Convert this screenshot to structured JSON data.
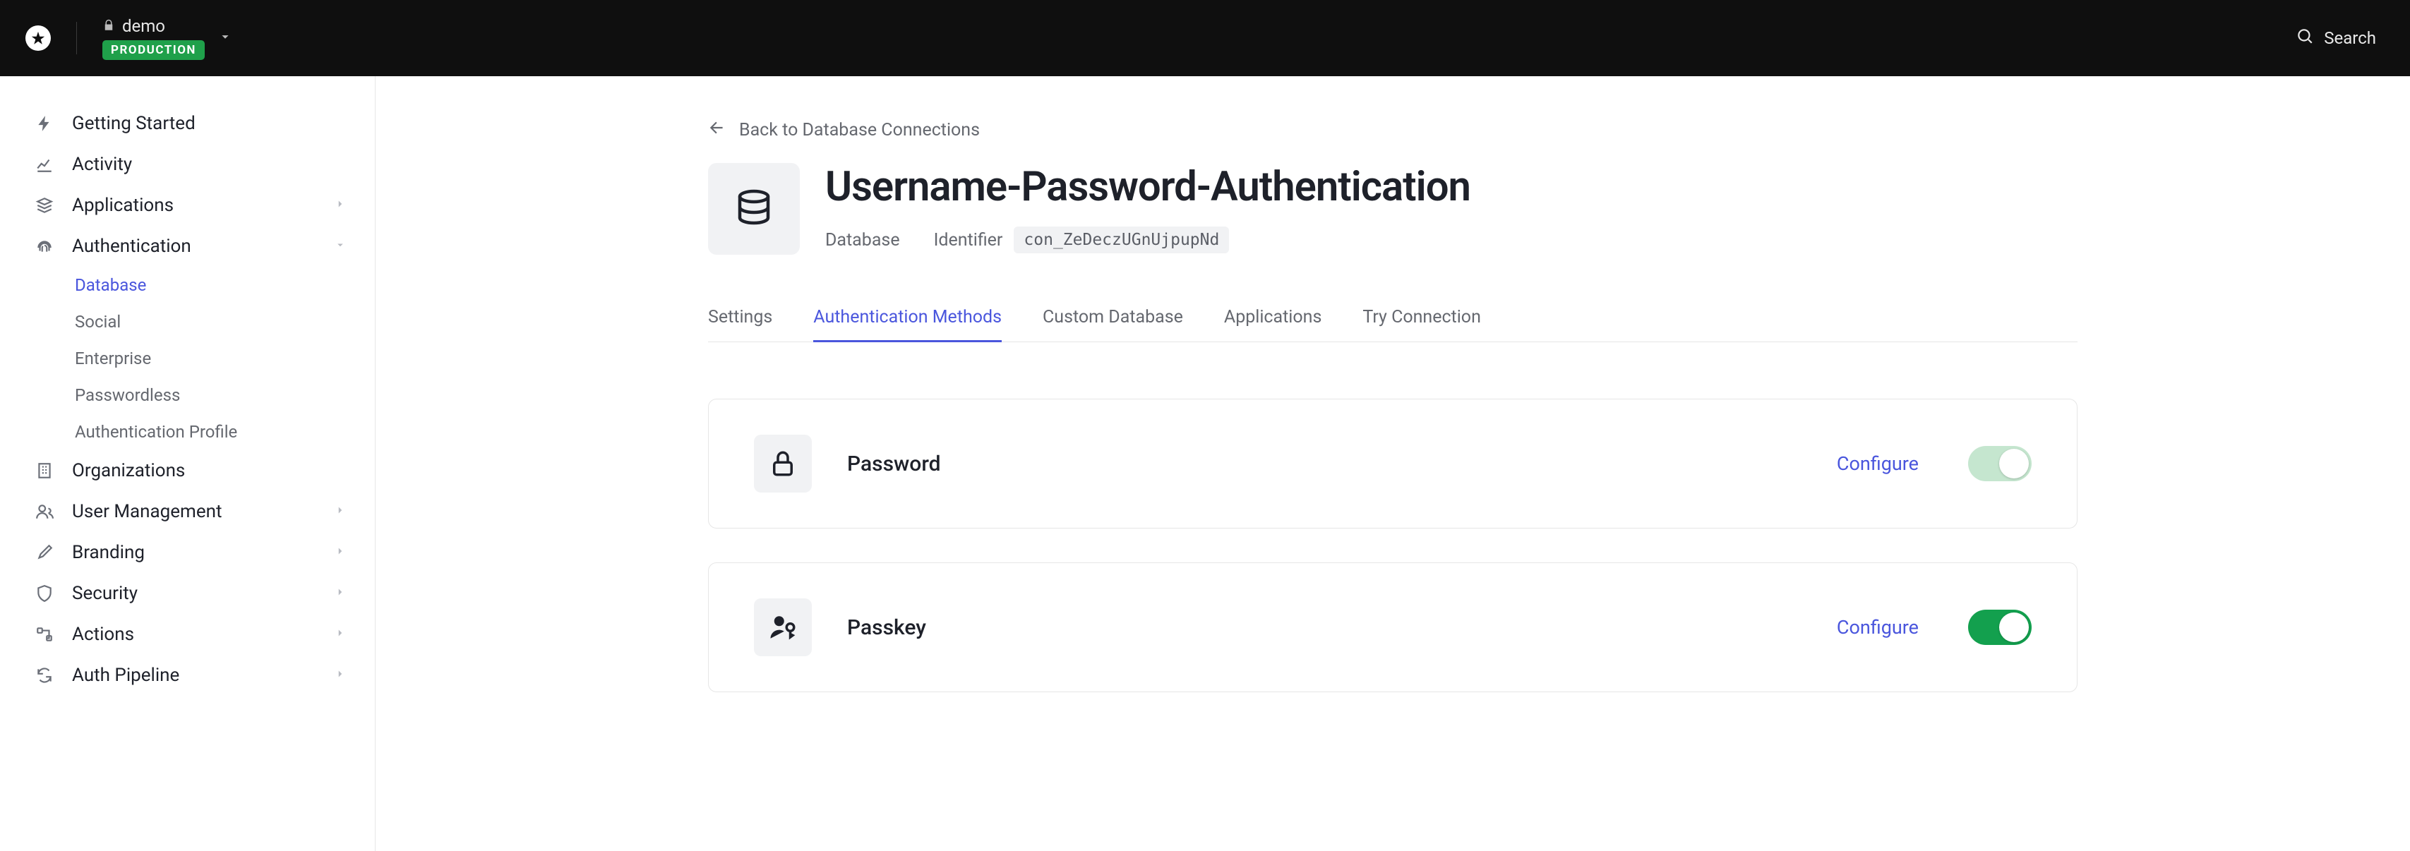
{
  "header": {
    "tenant_name": "demo",
    "environment": "PRODUCTION",
    "search_label": "Search"
  },
  "sidebar": {
    "items": [
      {
        "label": "Getting Started",
        "icon": "bolt",
        "expandable": false
      },
      {
        "label": "Activity",
        "icon": "chart",
        "expandable": false
      },
      {
        "label": "Applications",
        "icon": "stack",
        "expandable": true
      },
      {
        "label": "Authentication",
        "icon": "fingerprint",
        "expandable": true,
        "expanded": true,
        "children": [
          {
            "label": "Database",
            "active": true
          },
          {
            "label": "Social",
            "active": false
          },
          {
            "label": "Enterprise",
            "active": false
          },
          {
            "label": "Passwordless",
            "active": false
          },
          {
            "label": "Authentication Profile",
            "active": false
          }
        ]
      },
      {
        "label": "Organizations",
        "icon": "building",
        "expandable": false
      },
      {
        "label": "User Management",
        "icon": "users",
        "expandable": true
      },
      {
        "label": "Branding",
        "icon": "brush",
        "expandable": true
      },
      {
        "label": "Security",
        "icon": "shield",
        "expandable": true
      },
      {
        "label": "Actions",
        "icon": "flow",
        "expandable": true
      },
      {
        "label": "Auth Pipeline",
        "icon": "pipeline",
        "expandable": true
      }
    ]
  },
  "page": {
    "back_label": "Back to Database Connections",
    "title": "Username-Password-Authentication",
    "type_label": "Database",
    "identifier_label": "Identifier",
    "identifier_value": "con_ZeDeczUGnUjpupNd",
    "tabs": [
      {
        "label": "Settings",
        "active": false
      },
      {
        "label": "Authentication Methods",
        "active": true
      },
      {
        "label": "Custom Database",
        "active": false
      },
      {
        "label": "Applications",
        "active": false
      },
      {
        "label": "Try Connection",
        "active": false
      }
    ],
    "methods": [
      {
        "name": "Password",
        "icon": "lock",
        "configure_label": "Configure",
        "enabled": true,
        "locked": true
      },
      {
        "name": "Passkey",
        "icon": "passkey",
        "configure_label": "Configure",
        "enabled": true,
        "locked": false
      }
    ]
  }
}
